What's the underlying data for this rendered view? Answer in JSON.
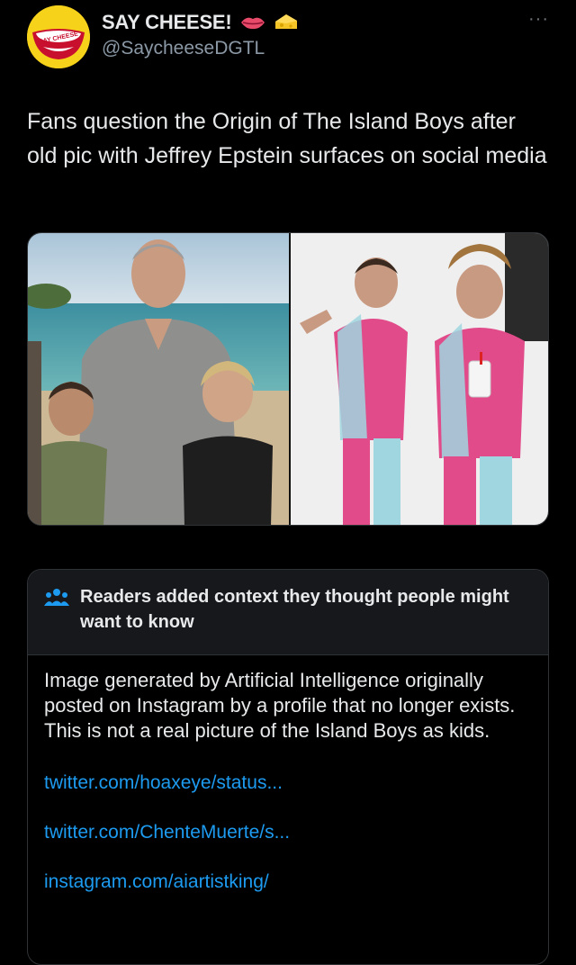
{
  "author": {
    "display_name": "SAY CHEESE!",
    "handle": "@SaycheeseDGTL",
    "avatar_text": "SAY CHEESE",
    "badges": [
      "lips-emoji",
      "cheese-emoji"
    ]
  },
  "more_label": "···",
  "tweet": {
    "text": "Fans question the Origin of The Island Boys after old pic with Jeffrey Epstein surfaces on social media"
  },
  "media": {
    "left_description": "man-with-two-boys-on-beach",
    "right_description": "two-tattooed-men-in-pink-tracksuits"
  },
  "community_note": {
    "title": "Readers added context they thought people might want to know",
    "body": "Image generated by Artificial Intelligence originally posted on Instagram by a profile that no longer exists. This is not a real picture of the Island Boys as kids.",
    "links": [
      "twitter.com/hoaxeye/status...",
      "twitter.com/ChenteMuerte/s...",
      "instagram.com/aiartistking/"
    ]
  },
  "colors": {
    "background": "#000000",
    "text": "#e7e9ea",
    "secondary": "#8b98a5",
    "link": "#1d9bf0",
    "border": "#2f3336",
    "avatar_yellow": "#f7d21b"
  }
}
